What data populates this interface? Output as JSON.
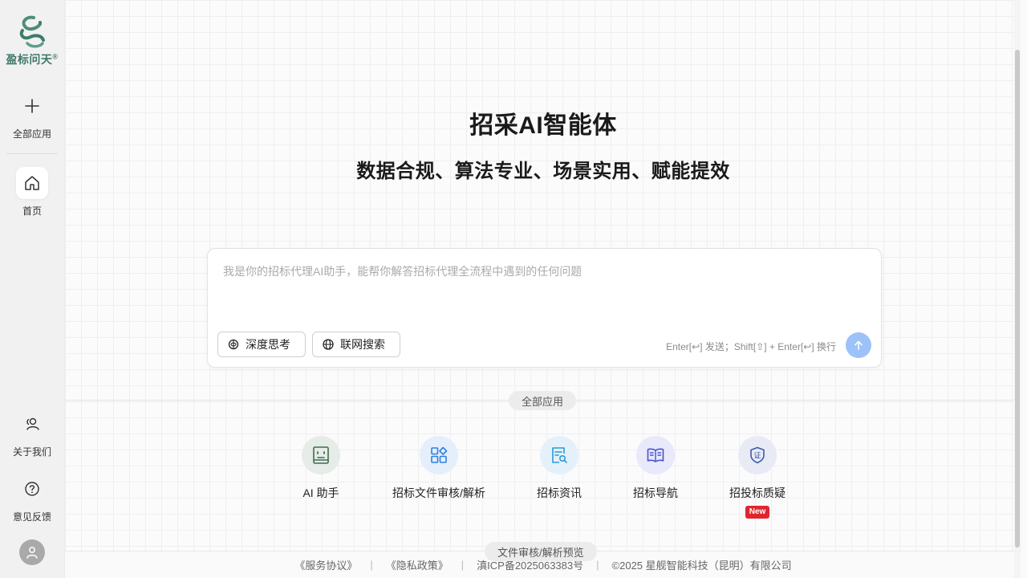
{
  "sidebar": {
    "logo_text": "盈标问天",
    "logo_reg": "®",
    "items": [
      {
        "label": "全部应用",
        "icon": "plus-icon"
      },
      {
        "label": "首页",
        "icon": "home-icon"
      },
      {
        "label": "关于我们",
        "icon": "users-icon"
      },
      {
        "label": "意见反馈",
        "icon": "help-circle-icon"
      }
    ],
    "avatar_icon": "user-icon"
  },
  "hero": {
    "title": "招采AI智能体",
    "subtitle": "数据合规、算法专业、场景实用、赋能提效"
  },
  "chat": {
    "placeholder": "我是你的招标代理AI助手，能帮你解答招标代理全流程中遇到的任何问题",
    "deep_think_label": "深度思考",
    "web_search_label": "联网搜索",
    "hint": "Enter[↩] 发送；Shift[⇧] + Enter[↩] 换行",
    "send_icon": "arrow-up-icon"
  },
  "apps_section": {
    "label": "全部应用",
    "apps": [
      {
        "label": "AI 助手",
        "icon": "robot-face-icon",
        "bg": "#e6ece8",
        "color": "#3f6e4f"
      },
      {
        "label": "招标文件审核/解析",
        "icon": "grid-apps-icon",
        "bg": "#e4effb",
        "color": "#2f7fe6"
      },
      {
        "label": "招标资讯",
        "icon": "doc-search-icon",
        "bg": "#e4f1fa",
        "color": "#2a9ad8"
      },
      {
        "label": "招标导航",
        "icon": "open-book-icon",
        "bg": "#e8e9fb",
        "color": "#4a52c9"
      },
      {
        "label": "招投标质疑",
        "icon": "shield-cert-icon",
        "bg": "#e8ebf6",
        "color": "#3d5aa8",
        "badge": "New"
      }
    ]
  },
  "preview_tab": "文件审核/解析预览",
  "footer": {
    "service": "《服务协议》",
    "privacy": "《隐私政策》",
    "icp": "滇ICP备2025063383号",
    "copyright": "©2025 星舰智能科技（昆明）有限公司"
  },
  "colors": {
    "brand": "#3f7a6a",
    "send_button": "#9cc2f7",
    "badge_red": "#e0262d"
  }
}
